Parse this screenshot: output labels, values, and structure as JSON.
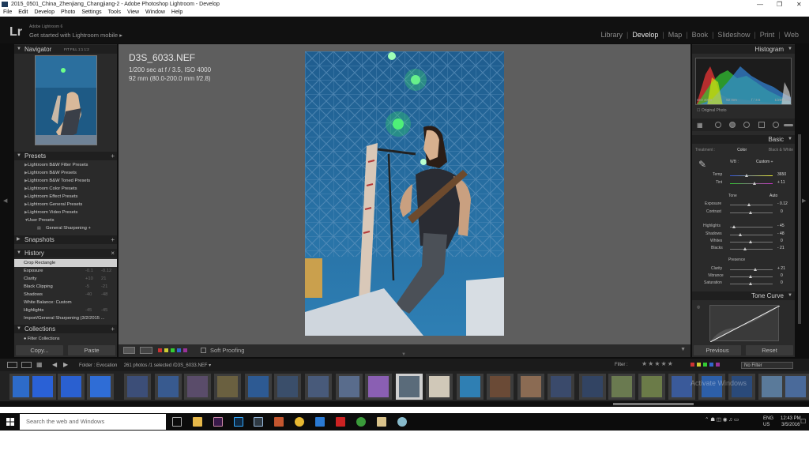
{
  "window": {
    "title": "2015_0501_China_Zhenjiang_Changjiang-2 - Adobe Photoshop Lightroom - Develop",
    "minimize": "—",
    "maximize": "❐",
    "close": "✕"
  },
  "menu": [
    "File",
    "Edit",
    "Develop",
    "Photo",
    "Settings",
    "Tools",
    "View",
    "Window",
    "Help"
  ],
  "identity": {
    "logo": "Lr",
    "app_name": "Adobe Lightroom 6",
    "mobile_link": "Get started with Lightroom mobile ▸"
  },
  "modules": [
    "Library",
    "Develop",
    "Map",
    "Book",
    "Slideshow",
    "Print",
    "Web"
  ],
  "active_module": "Develop",
  "left": {
    "navigator": {
      "title": "Navigator",
      "zoom": "FIT  FILL  1:1  1:2"
    },
    "presets": {
      "title": "Presets",
      "items": [
        "Lightroom B&W Filter Presets",
        "Lightroom B&W Presets",
        "Lightroom B&W Toned Presets",
        "Lightroom Color Presets",
        "Lightroom Effect Presets",
        "Lightroom General Presets",
        "Lightroom Video Presets",
        "User Presets"
      ],
      "sub_item": "General Sharpening +"
    },
    "snapshots": {
      "title": "Snapshots"
    },
    "history": {
      "title": "History",
      "close": "×",
      "items": [
        {
          "label": "Crop Rectangle",
          "v1": "",
          "v2": ""
        },
        {
          "label": "Exposure",
          "v1": "-0.1",
          "v2": "-0.12"
        },
        {
          "label": "Clarity",
          "v1": "+10",
          "v2": "21"
        },
        {
          "label": "Black Clipping",
          "v1": "-5",
          "v2": "-21"
        },
        {
          "label": "Shadows",
          "v1": "-40",
          "v2": "-48"
        },
        {
          "label": "White Balance: Custom",
          "v1": "",
          "v2": ""
        },
        {
          "label": "Highlights",
          "v1": "-45",
          "v2": "-45"
        },
        {
          "label": "Import/General Sharpening (3/2/2015 ...",
          "v1": "",
          "v2": ""
        }
      ]
    },
    "collections": {
      "title": "Collections",
      "first": "Filter Collections"
    },
    "copy_button": "Copy...",
    "paste_button": "Paste"
  },
  "center": {
    "filename": "D3S_6033.NEF",
    "exposure_line": "1/200 sec at f / 3.5, ISO 4000",
    "lens_line": "92 mm (80.0-200.0 mm f/2.8)",
    "soft_proofing": "Soft Proofing"
  },
  "right": {
    "histogram": {
      "title": "Histogram",
      "iso": "ISO 4000",
      "focal": "92 mm",
      "aperture": "f / 3.5",
      "shutter": "1/200 sec",
      "original_photo": "Original Photo"
    },
    "basic": {
      "title": "Basic",
      "treatment_label": "Treatment :",
      "treatment_color": "Color",
      "treatment_bw": "Black & White",
      "wb_label": "WB :",
      "wb_value": "Custom ÷",
      "temp_label": "Temp",
      "temp_value": "3650",
      "tint_label": "Tint",
      "tint_value": "+ 11",
      "tone_label": "Tone",
      "auto_label": "Auto",
      "exposure_label": "Exposure",
      "exposure_value": "- 0.12",
      "contrast_label": "Contrast",
      "contrast_value": "0",
      "highlights_label": "Highlights",
      "highlights_value": "- 45",
      "shadows_label": "Shadows",
      "shadows_value": "- 48",
      "whites_label": "Whites",
      "whites_value": "0",
      "blacks_label": "Blacks",
      "blacks_value": "- 21",
      "presence_label": "Presence",
      "clarity_label": "Clarity",
      "clarity_value": "+ 21",
      "vibrance_label": "Vibrance",
      "vibrance_value": "0",
      "saturation_label": "Saturation",
      "saturation_value": "0"
    },
    "tone_curve": {
      "title": "Tone Curve"
    },
    "previous_button": "Previous",
    "reset_button": "Reset"
  },
  "filmstrip": {
    "source": "Folder : Evocation",
    "count": "261 photos /1 selected /D3S_6033.NEF ▾",
    "filter_label": "Filter :",
    "stars": "★★★★★",
    "filter_value": "No Filter",
    "watermark": "Activate Windows"
  },
  "taskbar": {
    "search_placeholder": "Search the web and Windows",
    "language": "ENG",
    "region": "US",
    "time": "12:43 PM",
    "date": "3/5/2016"
  },
  "colors": {
    "panel": "#2a2a2a",
    "center_bg": "#5e5e5e",
    "chrome": "#0e0e0e"
  }
}
